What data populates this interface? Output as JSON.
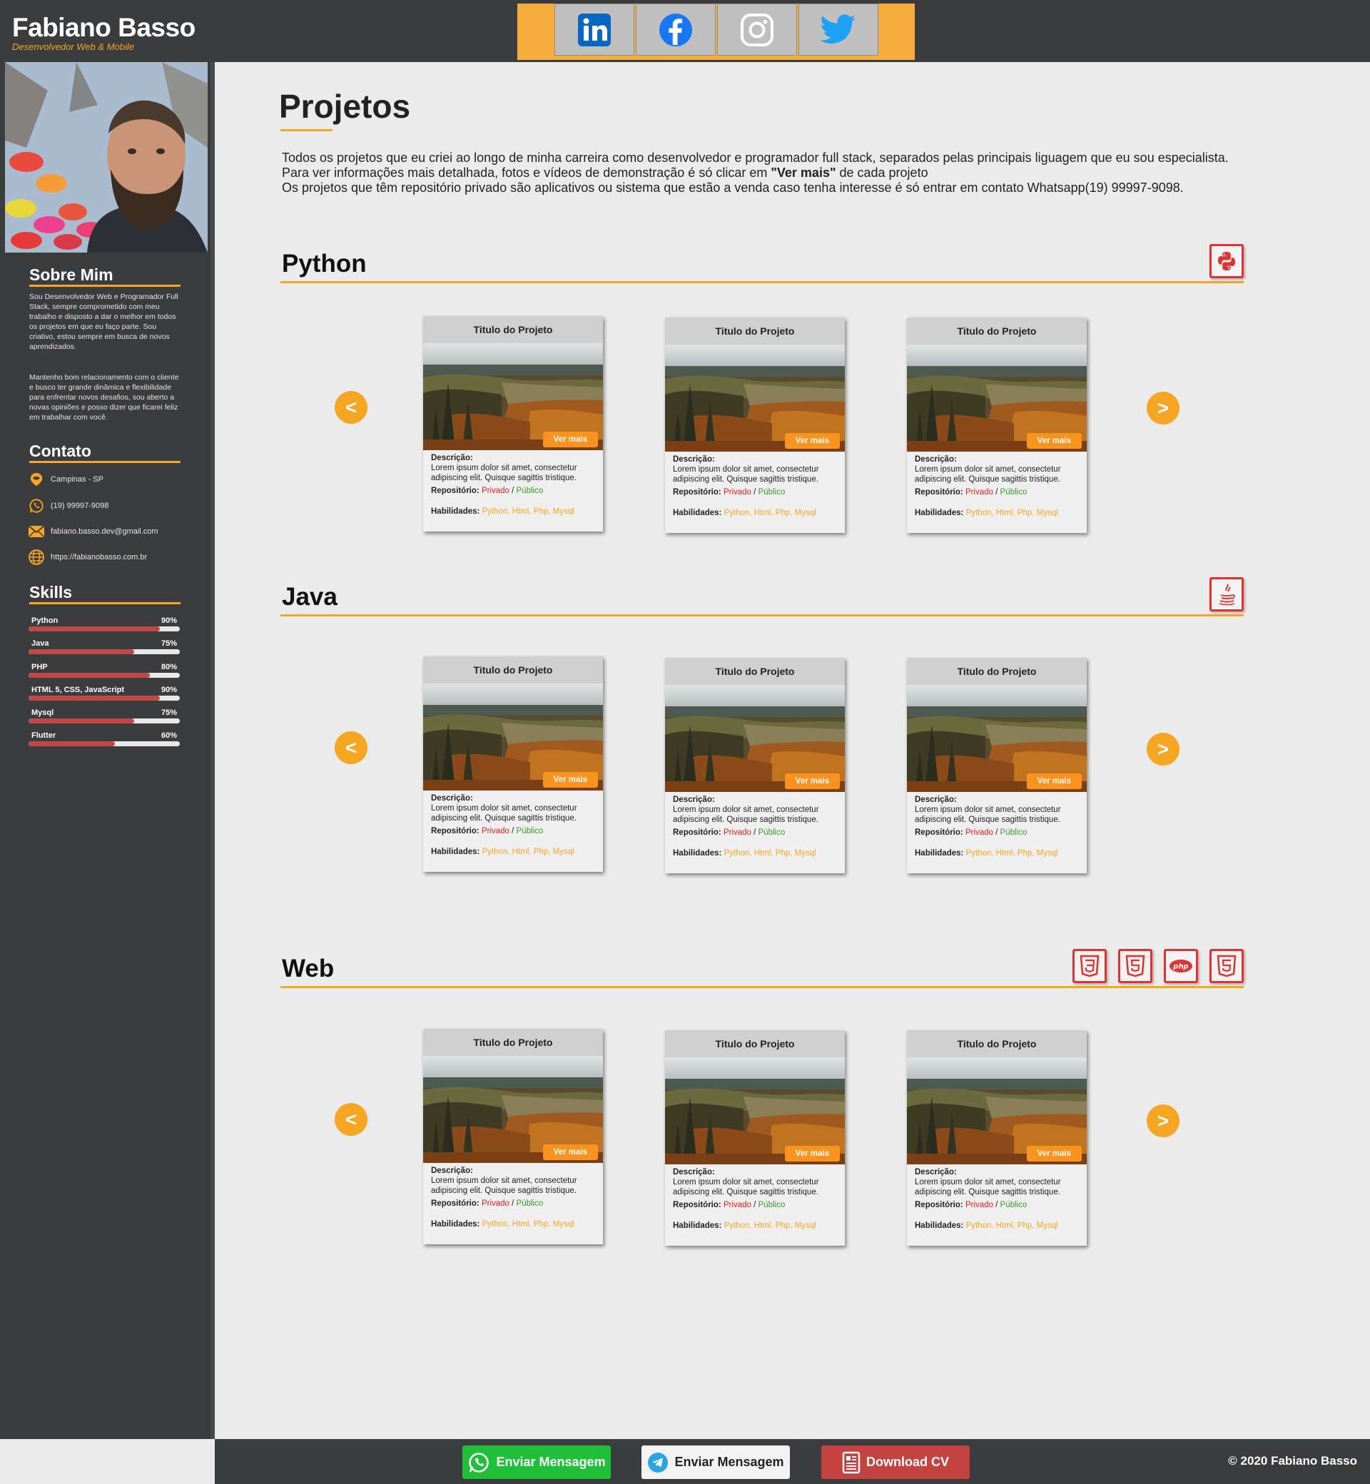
{
  "header": {
    "name": "Fabiano Basso",
    "subtitle": "Desenvolvedor Web & Mobile",
    "social": [
      {
        "icon": "linkedin-icon",
        "color": "#0a66c2"
      },
      {
        "icon": "facebook-icon",
        "color": "#1877f2"
      },
      {
        "icon": "instagram-icon",
        "color": "#ffffff"
      },
      {
        "icon": "twitter-icon",
        "color": "#1da1f2"
      }
    ]
  },
  "sidebar": {
    "about_title": "Sobre Mim",
    "about_p1": "Sou Desenvolvedor Web e Programador Full Stack, sempre comprometido com meu trabalho e disposto a dar o melhor em todos os projetos em que eu faço parte. Sou criativo, estou sempre em busca de novos aprendizados.",
    "about_p2": "Mantenho bom relacionamento com o cliente e busco ter grande dinâmica e flexibilidade para enfrentar novos desafios, sou aberto a novas opiniões e posso dizer que ficarei feliz em trabalhar com você.",
    "contact_title": "Contato",
    "contacts": [
      {
        "icon": "location-pin-icon",
        "text": "Campinas - SP"
      },
      {
        "icon": "whatsapp-icon",
        "text": "(19) 99997-9098"
      },
      {
        "icon": "email-icon",
        "text": "fabiano.basso.dev@gmail.com"
      },
      {
        "icon": "globe-icon",
        "text": "https://fabianobasso.com.br"
      }
    ],
    "skills_title": "Skills",
    "skills": [
      {
        "name": "Python",
        "pct": "90%",
        "value": 0.87
      },
      {
        "name": "Java",
        "pct": "75%",
        "value": 0.7
      },
      {
        "name": "PHP",
        "pct": "80%",
        "value": 0.8
      },
      {
        "name": "HTML 5, CSS, JavaScript",
        "pct": "90%",
        "value": 0.87
      },
      {
        "name": "Mysql",
        "pct": "75%",
        "value": 0.7
      },
      {
        "name": "Flutter",
        "pct": "60%",
        "value": 0.57
      }
    ],
    "accent": "#f5a623",
    "skill_bar_color": "#c04848"
  },
  "main": {
    "title": "Projetos",
    "intro_line1": "Todos os projetos que eu criei  ao longo de minha carreira  como desenvolvedor e programador full stack, separados pelas principais liguagem que eu sou especialista.",
    "intro_line2_pre": "Para ver informações mais detalhada, fotos e vídeos de demonstração é só clicar em ",
    "intro_line2_bold": "\"Ver mais\"",
    "intro_line2_post": "  de cada projeto",
    "intro_line3": "Os projetos que têm repositório privado são aplicativos ou sistema que estão a venda caso tenha interesse é só entrar em contato Whatsapp(19) 99997-9098.",
    "prev_label": "<",
    "next_label": ">",
    "card": {
      "title": "Titulo do Projeto",
      "button": "Ver mais",
      "desc_label": "Descrição:",
      "desc_text": "Lorem ipsum dolor sit amet, consectetur adipiscing elit. Quisque sagittis tristique.",
      "repo_label": "Repositório:",
      "repo_private": "Privado",
      "repo_sep": " / ",
      "repo_public": "Público",
      "skills_label": "Habilidades:",
      "skills_value": "Python, Html, Php, Mysql"
    },
    "sections": [
      {
        "name": "Python",
        "icons": [
          "python-icon"
        ]
      },
      {
        "name": "Java",
        "icons": [
          "java-icon"
        ]
      },
      {
        "name": "Web",
        "icons": [
          "css3-icon",
          "html5-icon",
          "php-icon",
          "html5-icon"
        ]
      }
    ]
  },
  "footer": {
    "whatsapp_label": "Enviar Mensagem",
    "telegram_label": "Enviar Mensagem",
    "cv_label": "Download CV",
    "copyright": "© 2020 Fabiano Basso"
  }
}
